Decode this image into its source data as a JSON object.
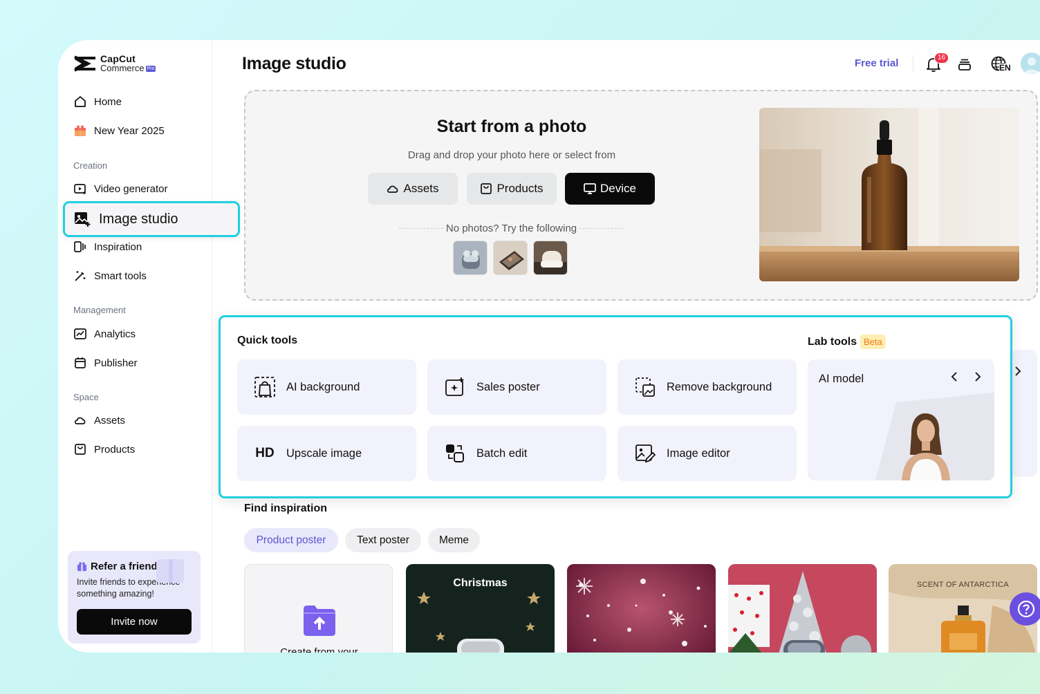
{
  "app": {
    "brand_line1": "CapCut",
    "brand_line2": "Commerce",
    "brand_badge": "Pro"
  },
  "sidebar": {
    "home": "Home",
    "new_year": "New Year 2025",
    "creation_label": "Creation",
    "video_generator": "Video generator",
    "image_studio": "Image studio",
    "inspiration": "Inspiration",
    "smart_tools": "Smart tools",
    "management_label": "Management",
    "analytics": "Analytics",
    "publisher": "Publisher",
    "space_label": "Space",
    "assets": "Assets",
    "products": "Products",
    "refer": {
      "title": "Refer a friend",
      "desc": "Invite friends to experience something amazing!",
      "button": "Invite now"
    }
  },
  "header": {
    "title": "Image studio",
    "free_trial": "Free trial",
    "notification_count": "16",
    "language": "EN"
  },
  "upload": {
    "title": "Start from a photo",
    "subtitle": "Drag and drop your photo here or select from",
    "buttons": {
      "assets": "Assets",
      "products": "Products",
      "device": "Device"
    },
    "no_photos": "No photos? Try the following"
  },
  "quick_tools": {
    "heading": "Quick tools",
    "items": {
      "ai_background": "AI background",
      "sales_poster": "Sales poster",
      "remove_background": "Remove background",
      "upscale_icon": "HD",
      "upscale_image": "Upscale image",
      "batch_edit": "Batch edit",
      "image_editor": "Image editor"
    }
  },
  "lab_tools": {
    "heading": "Lab tools",
    "badge": "Beta",
    "card_title": "AI model"
  },
  "find_inspiration": {
    "title": "Find inspiration",
    "chips": {
      "product_poster": "Product poster",
      "text_poster": "Text poster",
      "meme": "Meme"
    },
    "create_card": "Create from your",
    "christmas": "Christmas",
    "perfume": "SCENT OF ANTARCTICA"
  },
  "colors": {
    "accent": "#5b56d6",
    "highlight": "#1fcfdf",
    "tool_bg": "#f2f2fd"
  }
}
